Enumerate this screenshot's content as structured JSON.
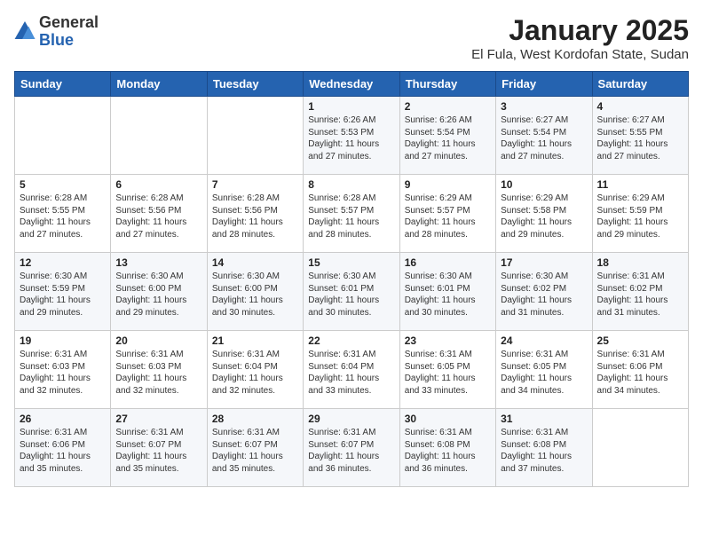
{
  "header": {
    "logo_general": "General",
    "logo_blue": "Blue",
    "title": "January 2025",
    "subtitle": "El Fula, West Kordofan State, Sudan"
  },
  "weekdays": [
    "Sunday",
    "Monday",
    "Tuesday",
    "Wednesday",
    "Thursday",
    "Friday",
    "Saturday"
  ],
  "weeks": [
    [
      {
        "day": "",
        "info": ""
      },
      {
        "day": "",
        "info": ""
      },
      {
        "day": "",
        "info": ""
      },
      {
        "day": "1",
        "info": "Sunrise: 6:26 AM\nSunset: 5:53 PM\nDaylight: 11 hours\nand 27 minutes."
      },
      {
        "day": "2",
        "info": "Sunrise: 6:26 AM\nSunset: 5:54 PM\nDaylight: 11 hours\nand 27 minutes."
      },
      {
        "day": "3",
        "info": "Sunrise: 6:27 AM\nSunset: 5:54 PM\nDaylight: 11 hours\nand 27 minutes."
      },
      {
        "day": "4",
        "info": "Sunrise: 6:27 AM\nSunset: 5:55 PM\nDaylight: 11 hours\nand 27 minutes."
      }
    ],
    [
      {
        "day": "5",
        "info": "Sunrise: 6:28 AM\nSunset: 5:55 PM\nDaylight: 11 hours\nand 27 minutes."
      },
      {
        "day": "6",
        "info": "Sunrise: 6:28 AM\nSunset: 5:56 PM\nDaylight: 11 hours\nand 27 minutes."
      },
      {
        "day": "7",
        "info": "Sunrise: 6:28 AM\nSunset: 5:56 PM\nDaylight: 11 hours\nand 28 minutes."
      },
      {
        "day": "8",
        "info": "Sunrise: 6:28 AM\nSunset: 5:57 PM\nDaylight: 11 hours\nand 28 minutes."
      },
      {
        "day": "9",
        "info": "Sunrise: 6:29 AM\nSunset: 5:57 PM\nDaylight: 11 hours\nand 28 minutes."
      },
      {
        "day": "10",
        "info": "Sunrise: 6:29 AM\nSunset: 5:58 PM\nDaylight: 11 hours\nand 29 minutes."
      },
      {
        "day": "11",
        "info": "Sunrise: 6:29 AM\nSunset: 5:59 PM\nDaylight: 11 hours\nand 29 minutes."
      }
    ],
    [
      {
        "day": "12",
        "info": "Sunrise: 6:30 AM\nSunset: 5:59 PM\nDaylight: 11 hours\nand 29 minutes."
      },
      {
        "day": "13",
        "info": "Sunrise: 6:30 AM\nSunset: 6:00 PM\nDaylight: 11 hours\nand 29 minutes."
      },
      {
        "day": "14",
        "info": "Sunrise: 6:30 AM\nSunset: 6:00 PM\nDaylight: 11 hours\nand 30 minutes."
      },
      {
        "day": "15",
        "info": "Sunrise: 6:30 AM\nSunset: 6:01 PM\nDaylight: 11 hours\nand 30 minutes."
      },
      {
        "day": "16",
        "info": "Sunrise: 6:30 AM\nSunset: 6:01 PM\nDaylight: 11 hours\nand 30 minutes."
      },
      {
        "day": "17",
        "info": "Sunrise: 6:30 AM\nSunset: 6:02 PM\nDaylight: 11 hours\nand 31 minutes."
      },
      {
        "day": "18",
        "info": "Sunrise: 6:31 AM\nSunset: 6:02 PM\nDaylight: 11 hours\nand 31 minutes."
      }
    ],
    [
      {
        "day": "19",
        "info": "Sunrise: 6:31 AM\nSunset: 6:03 PM\nDaylight: 11 hours\nand 32 minutes."
      },
      {
        "day": "20",
        "info": "Sunrise: 6:31 AM\nSunset: 6:03 PM\nDaylight: 11 hours\nand 32 minutes."
      },
      {
        "day": "21",
        "info": "Sunrise: 6:31 AM\nSunset: 6:04 PM\nDaylight: 11 hours\nand 32 minutes."
      },
      {
        "day": "22",
        "info": "Sunrise: 6:31 AM\nSunset: 6:04 PM\nDaylight: 11 hours\nand 33 minutes."
      },
      {
        "day": "23",
        "info": "Sunrise: 6:31 AM\nSunset: 6:05 PM\nDaylight: 11 hours\nand 33 minutes."
      },
      {
        "day": "24",
        "info": "Sunrise: 6:31 AM\nSunset: 6:05 PM\nDaylight: 11 hours\nand 34 minutes."
      },
      {
        "day": "25",
        "info": "Sunrise: 6:31 AM\nSunset: 6:06 PM\nDaylight: 11 hours\nand 34 minutes."
      }
    ],
    [
      {
        "day": "26",
        "info": "Sunrise: 6:31 AM\nSunset: 6:06 PM\nDaylight: 11 hours\nand 35 minutes."
      },
      {
        "day": "27",
        "info": "Sunrise: 6:31 AM\nSunset: 6:07 PM\nDaylight: 11 hours\nand 35 minutes."
      },
      {
        "day": "28",
        "info": "Sunrise: 6:31 AM\nSunset: 6:07 PM\nDaylight: 11 hours\nand 35 minutes."
      },
      {
        "day": "29",
        "info": "Sunrise: 6:31 AM\nSunset: 6:07 PM\nDaylight: 11 hours\nand 36 minutes."
      },
      {
        "day": "30",
        "info": "Sunrise: 6:31 AM\nSunset: 6:08 PM\nDaylight: 11 hours\nand 36 minutes."
      },
      {
        "day": "31",
        "info": "Sunrise: 6:31 AM\nSunset: 6:08 PM\nDaylight: 11 hours\nand 37 minutes."
      },
      {
        "day": "",
        "info": ""
      }
    ]
  ]
}
